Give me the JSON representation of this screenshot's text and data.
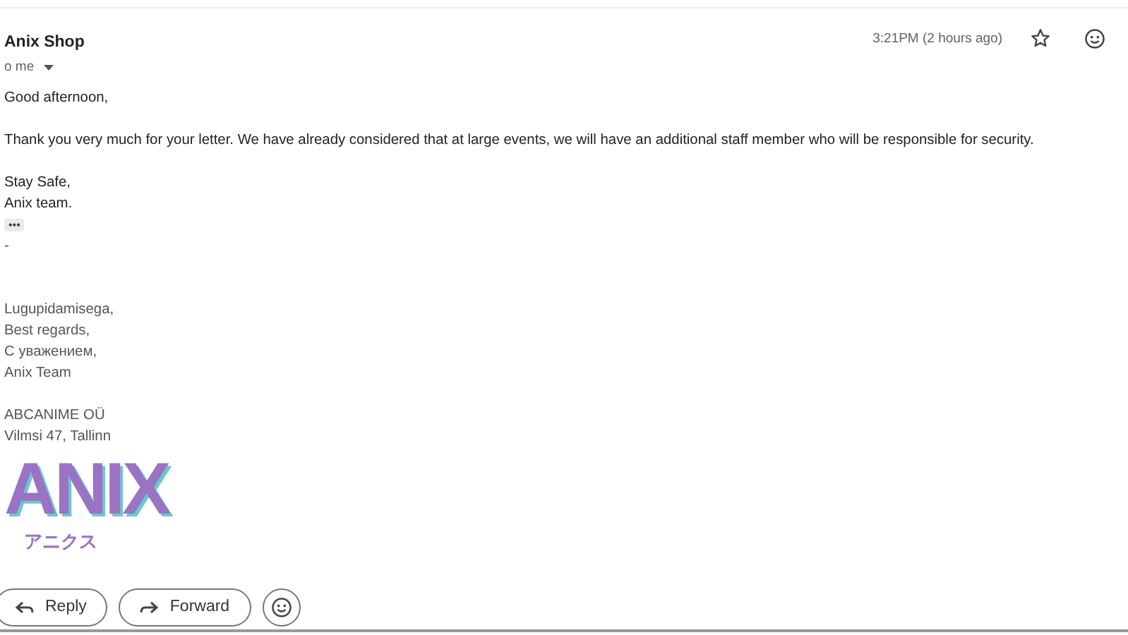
{
  "message": {
    "sender": "Anix Shop",
    "recipient": "o me",
    "time": "3:21PM (2 hours ago)",
    "starred": false,
    "body": [
      [
        "Good afternoon,"
      ],
      [
        "Thank you very much for your letter. We have already considered that at large events, we will have an additional staff member who will be responsible for security."
      ],
      [
        "Stay Safe,",
        "Anix team."
      ]
    ],
    "quote_toggle": "•••",
    "signature": [
      [
        "-"
      ],
      [
        "Lugupidamisega,",
        "Best regards,",
        "С уважением,",
        "Anix Team"
      ],
      [
        "ABCANIME OÜ",
        "Vilmsi 47, Tallinn"
      ]
    ],
    "logo": {
      "name": "ANIX",
      "subtitle": "アニクス"
    }
  },
  "actions": [
    {
      "label": "Reply",
      "kind": "reply"
    },
    {
      "label": "Forward",
      "kind": "forward"
    },
    {
      "kind": "emoji"
    }
  ]
}
